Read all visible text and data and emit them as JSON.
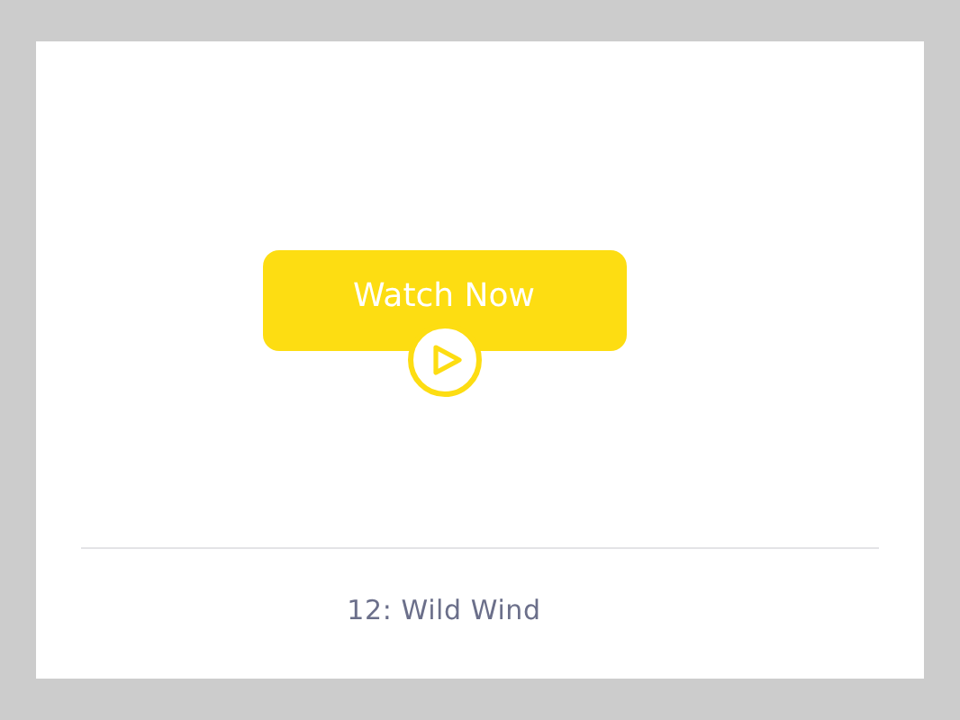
{
  "button": {
    "label": "Watch Now"
  },
  "title": "12: Wild Wind"
}
